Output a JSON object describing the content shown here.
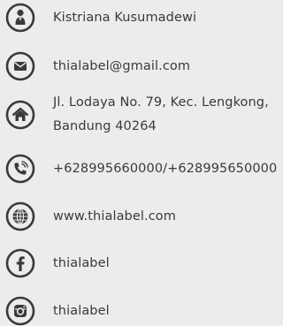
{
  "colors": {
    "background": "#ececec",
    "icon": "#3a3a3a",
    "text": "#3a3a3a"
  },
  "contacts": [
    {
      "icon": "person-icon",
      "text": "Kistriana Kusumadewi"
    },
    {
      "icon": "email-icon",
      "text": "thialabel@gmail.com"
    },
    {
      "icon": "home-icon",
      "lines": [
        "Jl. Lodaya No. 79, Kec. Lengkong,",
        "Bandung 40264"
      ]
    },
    {
      "icon": "phone-icon",
      "text": "+628995660000/+628995650000"
    },
    {
      "icon": "globe-icon",
      "text": "www.thialabel.com"
    },
    {
      "icon": "facebook-icon",
      "text": "thialabel"
    },
    {
      "icon": "instagram-icon",
      "text": "thialabel"
    }
  ]
}
